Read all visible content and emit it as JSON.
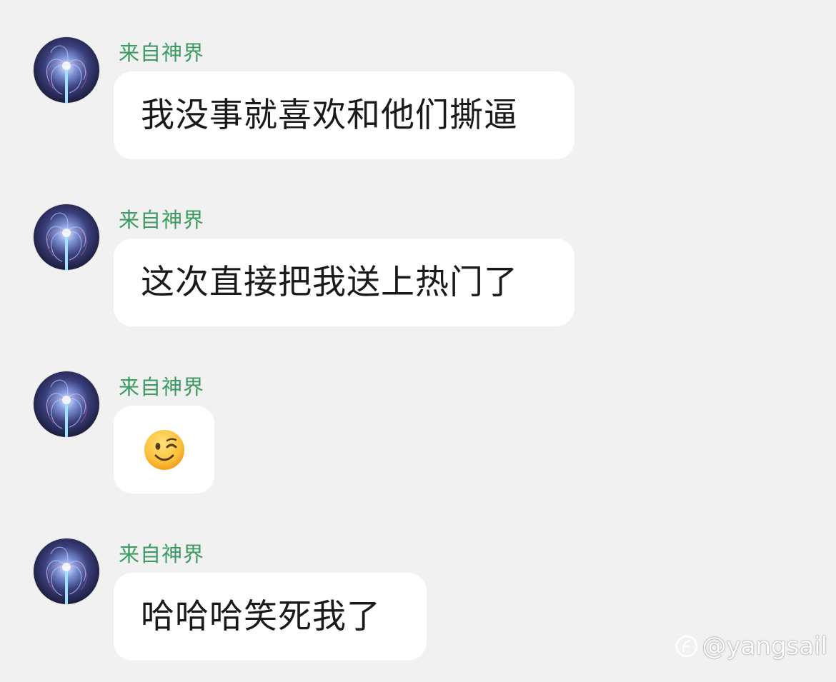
{
  "messages": [
    {
      "sender": "来自神界",
      "text": "我没事就喜欢和他们撕逼",
      "kind": "text"
    },
    {
      "sender": "来自神界",
      "text": "这次直接把我送上热门了",
      "kind": "text"
    },
    {
      "sender": "来自神界",
      "text": "",
      "kind": "emoji",
      "emoji": "winking-face-icon"
    },
    {
      "sender": "来自神界",
      "text": "哈哈哈笑死我了",
      "kind": "text"
    }
  ],
  "watermark": {
    "handle": "@yangsail",
    "icon": "platform-logo-icon"
  },
  "colors": {
    "background": "#f1f1f1",
    "bubble": "#ffffff",
    "sender_name": "#3d9a62",
    "text": "#1a1a1a"
  }
}
